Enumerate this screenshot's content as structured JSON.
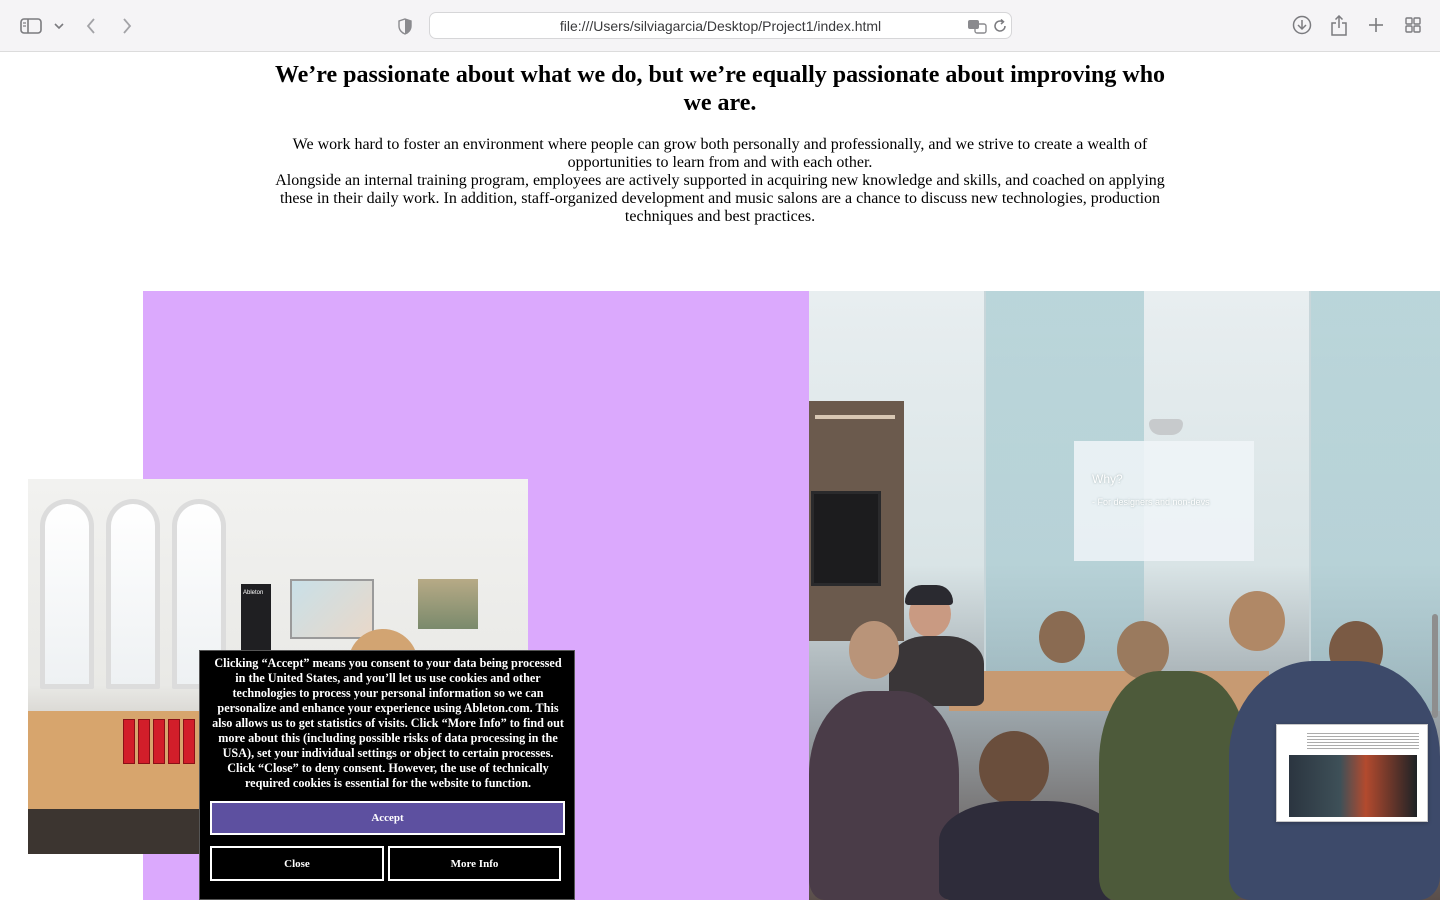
{
  "browser": {
    "url": "file:///Users/silviagarcia/Desktop/Project1/index.html",
    "icons": {
      "sidebar": "sidebar-icon",
      "chevron": "chevron-down-icon",
      "back": "back-arrow-icon",
      "forward": "forward-arrow-icon",
      "privacy": "shield-icon",
      "translate": "translate-icon",
      "reload": "reload-icon",
      "downloads": "download-icon",
      "share": "share-icon",
      "new_tab": "plus-icon",
      "tab_overview": "grid-icon"
    }
  },
  "page": {
    "heading": "We’re passionate about what we do, but we’re equally passionate about improving who we are.",
    "paragraph_1": "We work hard to foster an environment where people can grow both personally and professionally, and we strive to create a wealth of opportunities to learn from and with each other.",
    "paragraph_2": "Alongside an internal training program, employees are actively supported in acquiring new knowledge and skills, and coached on applying these in their daily work. In addition, staff-organized development and music salons are a chance to discuss new technologies, production techniques and best practices.",
    "panel_color": "#dba9fd",
    "photo_presentation": {
      "slide_title": "Why?",
      "slide_bullet": "-  For designers and non-devs"
    },
    "photo_office": {
      "banner_text": "Ableton"
    }
  },
  "cookie_banner": {
    "text": "Clicking “Accept” means you consent to your data being processed in the United States, and you’ll let us use cookies and other technologies to process your personal information so we can personalize and enhance your experience using Ableton.com. This also allows us to get statistics of visits. Click “More Info” to find out more about this (including possible risks of data processing in the USA), set your individual settings or object to certain processes. Click “Close” to deny consent. However, the use of technically required cookies is essential for the website to function.",
    "accept_label": "Accept",
    "close_label": "Close",
    "more_info_label": "More Info",
    "accent_color": "#5d50a0"
  }
}
